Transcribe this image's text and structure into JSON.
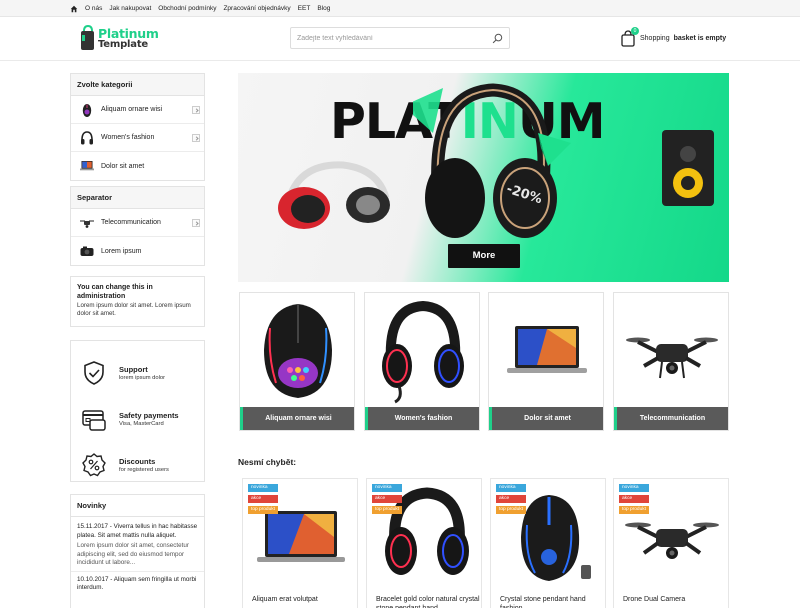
{
  "topbar": {
    "home_icon": "home-icon",
    "links": [
      "O nás",
      "Jak nakupovat",
      "Obchodní podmínky",
      "Zpracování objednávky",
      "EET",
      "Blog"
    ]
  },
  "header": {
    "logo_line1": "Platinum",
    "logo_line2": "Template",
    "search_placeholder": "Zadejte text vyhledávání",
    "basket_count": "0",
    "basket_prefix": "Shopping",
    "basket_status": "basket is empty"
  },
  "sidebar": {
    "categories_title": "Zvolte kategorii",
    "categories": [
      {
        "label": "Aliquam ornare wisi",
        "icon": "mouse-icon"
      },
      {
        "label": "Women's fashion",
        "icon": "headphones-icon"
      },
      {
        "label": "Dolor sit amet",
        "icon": "laptop-icon"
      }
    ],
    "separator_title": "Separator",
    "separator_items": [
      {
        "label": "Telecommunication",
        "icon": "drone-icon"
      },
      {
        "label": "Lorem ipsum",
        "icon": "camera-icon"
      }
    ],
    "info": {
      "title": "You can change this in administration",
      "text": "Lorem ipsum dolor sit amet. Lorem ipsum dolor sit amet."
    },
    "benefits": [
      {
        "title": "Support",
        "desc": "lorem ipsum dolor",
        "icon": "shield-check-icon"
      },
      {
        "title": "Safety payments",
        "desc": "Visa, MasterCard",
        "icon": "credit-card-icon"
      },
      {
        "title": "Discounts",
        "desc": "for registered users",
        "icon": "discount-icon"
      }
    ],
    "news_title": "Novinky",
    "news": [
      {
        "title": "15.11.2017 - Viverra tellus in hac habitasse platea. Sit amet mattis nulla aliquet.",
        "text": "Lorem ipsum dolor sit amet, consectetur adipiscing elit, sed do eiusmod tempor incididunt ut labore..."
      },
      {
        "title": "10.10.2017 - Aliquam sem fringilla ut morbi interdum.",
        "text": ""
      }
    ]
  },
  "banner": {
    "text_dark1": "PLAT",
    "text_green": "IN",
    "text_dark2": "UM",
    "badge": "-20%",
    "button": "More"
  },
  "tiles": [
    {
      "label": "Aliquam ornare wisi",
      "icon": "gaming-mouse-icon"
    },
    {
      "label": "Women's fashion",
      "icon": "headset-icon"
    },
    {
      "label": "Dolor sit amet",
      "icon": "laptop-icon"
    },
    {
      "label": "Telecommunication",
      "icon": "drone-icon"
    }
  ],
  "section_title": "Nesmí chybět:",
  "products": [
    {
      "tags": [
        "novinka",
        "akce",
        "top produkt"
      ],
      "name": "Aliquam erat volutpat",
      "icon": "laptop-icon"
    },
    {
      "tags": [
        "novinka",
        "akce",
        "top produkt"
      ],
      "name": "Bracelet gold color natural crystal stone pendant hand",
      "icon": "headset-icon"
    },
    {
      "tags": [
        "novinka",
        "akce",
        "top produkt"
      ],
      "name": "Crystal stone pendant hand fashion",
      "icon": "gaming-mouse-icon"
    },
    {
      "tags": [
        "novinka",
        "akce",
        "top produkt"
      ],
      "name": "Drone Dual Camera",
      "icon": "drone-icon"
    }
  ],
  "colors": {
    "accent": "#1fd08a",
    "tile_label_bg": "#5a5a5a",
    "tag_new": "#3aa7dc",
    "tag_sale": "#e0453a",
    "tag_top": "#f0a030"
  }
}
